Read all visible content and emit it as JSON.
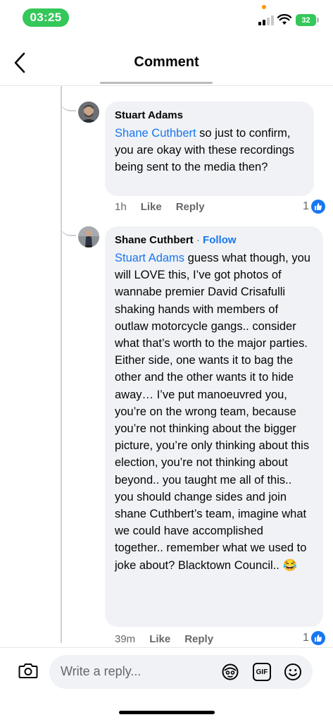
{
  "status_bar": {
    "time": "03:25",
    "battery": "32"
  },
  "header": {
    "title": "Comment"
  },
  "comments": [
    {
      "author": "Stuart Adams",
      "mention": "Shane Cuthbert",
      "text": " so just to confirm, you are okay with these recordings being sent to the media then?",
      "time": "1h",
      "like_label": "Like",
      "reply_label": "Reply",
      "reaction_count": "1"
    },
    {
      "author": "Shane Cuthbert",
      "separator": "·",
      "follow_label": "Follow",
      "mention": "Stuart Adams",
      "text": " guess what though, you will LOVE this, I’ve got photos of wannabe premier David Crisafulli shaking hands with members of outlaw motorcycle gangs.. consider what that’s worth to the major parties. Either side, one wants it to bag the other and the other wants it to hide away… I’ve put manoeuvred you, you’re on the wrong team, because you’re not thinking about the bigger picture, you’re only thinking about this election, you’re not thinking about beyond.. you taught me all of this.. you should change sides and join shane Cuthbert’s team, imagine what we could have accomplished together.. remember what we used to joke about? Blacktown Council.. ",
      "emoji": "😂",
      "time": "39m",
      "like_label": "Like",
      "reply_label": "Reply",
      "reaction_count": "1"
    }
  ],
  "reply_bar": {
    "placeholder": "Write a reply...",
    "gif_label": "GIF"
  },
  "icons": {
    "back": "chevron-left-icon",
    "camera": "camera-icon",
    "avatar_sticker": "avatar-sticker-icon",
    "gif": "gif-icon",
    "emoji": "smiley-icon",
    "like": "thumbs-up-icon"
  },
  "colors": {
    "accent": "#1877f2",
    "bubble": "#f0f2f5",
    "status_green": "#34c759",
    "muted": "#65676b"
  }
}
